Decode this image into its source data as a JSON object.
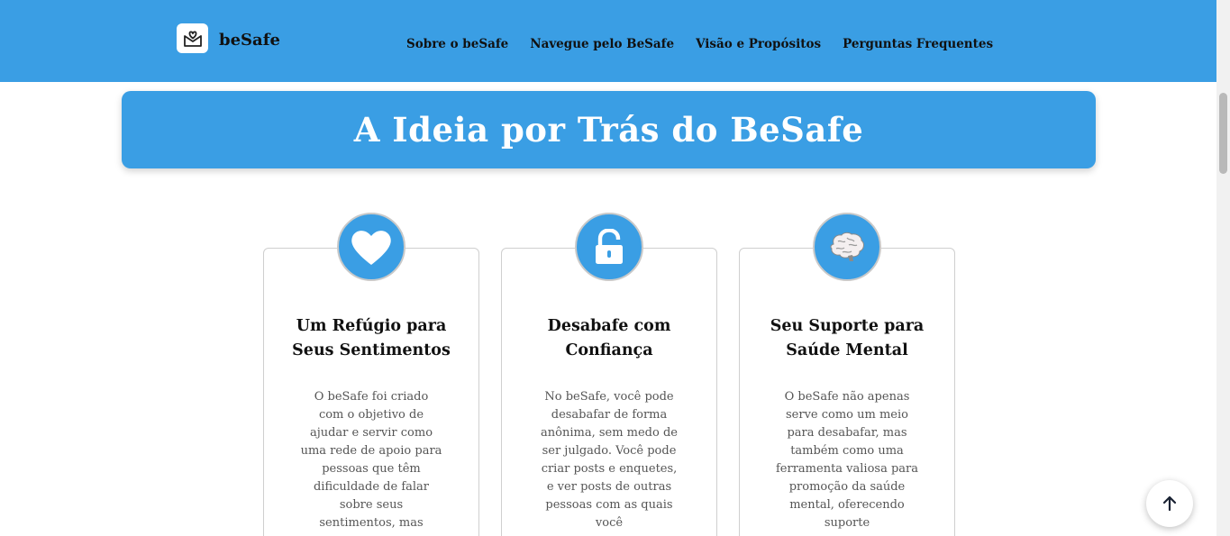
{
  "header": {
    "brand": "beSafe",
    "nav": [
      "Sobre o beSafe",
      "Navegue pelo BeSafe",
      "Visão e Propósitos",
      "Perguntas Frequentes"
    ]
  },
  "banner": {
    "title": "A Ideia por Trás do BeSafe"
  },
  "cards": [
    {
      "icon": "heart-icon",
      "title": "Um Refúgio para Seus Sentimentos",
      "text": "O beSafe foi criado com o objetivo de ajudar e servir como uma rede de apoio para pessoas que têm dificuldade de falar sobre seus sentimentos, mas"
    },
    {
      "icon": "unlock-icon",
      "title": "Desabafe com Confiança",
      "text": "No beSafe, você pode desabafar de forma anônima, sem medo de ser julgado. Você pode criar posts e enquetes, e ver posts de outras pessoas com as quais você"
    },
    {
      "icon": "brain-icon",
      "title": "Seu Suporte para Saúde Mental",
      "text": "O beSafe não apenas serve como um meio para desabafar, mas também como uma ferramenta valiosa para promoção da saúde mental, oferecendo suporte"
    }
  ],
  "colors": {
    "primary": "#3a9ee4",
    "text": "#111111",
    "muted": "#555555"
  }
}
